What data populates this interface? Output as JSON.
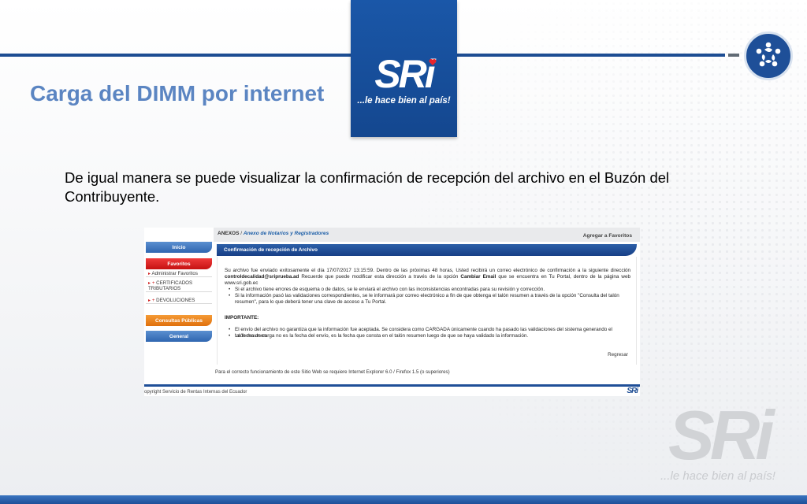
{
  "header": {
    "title": "Carga del DIMM por internet",
    "logo_text": "SRi",
    "logo_slogan": "...le hace bien al país!"
  },
  "body_text": "De igual manera se puede visualizar la confirmación de recepción del archivo en el Buzón del Contribuyente.",
  "screenshot": {
    "breadcrumb_section": "ANEXOS",
    "breadcrumb_page": "Anexo de Notarios y Registradores",
    "add_favorites": "Agregar a Favoritos",
    "menu": {
      "inicio": "Inicio",
      "favoritos": "Favoritos",
      "administrar": "Administrar Favoritos",
      "certificados": "CERTIFICADOS TRIBUTARIOS",
      "devoluciones": "DEVOLUCIONES",
      "consultas": "Consultas Públicas",
      "general": "General"
    },
    "panel_title": "Confirmación de recepción de Archivo",
    "message_intro": "Su archivo fue enviado exitosamente el día 17/07/2017 13:15:59. Dentro de las próximas 48 horas, Usted recibirá un correo electrónico de confirmación a la siguiente dirección ",
    "email": "controldecalidad@sriprueba.ad",
    "message_mid": " Recuerde que puede modificar esta dirección a través de la opción ",
    "option_name": "Cambiar Email",
    "message_end": " que se encuentra en Tu Portal, dentro de la página web www.sri.gob.ec",
    "bullets": [
      "Si el archivo tiene errores de esquema o de datos, se le enviará el archivo con las inconsistencias encontradas para su revisión y corrección.",
      "Si la información pasó las validaciones correspondientes, se le informará por correo electrónico a fin de que obtenga el talón resumen a través de la opción \"Consulta del talón resumen\", para lo que deberá tener una clave de acceso a Tu Portal."
    ],
    "important_label": "IMPORTANTE:",
    "important_bullets": [
      "El envío del archivo no garantiza que la información fue aceptada. Se considera como CARGADA únicamente cuando ha pasado las validaciones del sistema generando el talón resumen.",
      "La fecha de carga no es la fecha del envío, es la fecha que consta en el talón resumen luego de que se haya validado la información."
    ],
    "back_link": "Regresar",
    "footer_note": "Para el correcto funcionamiento de este Sitio Web se requiere Internet Explorer 6.0 / Firefox 1.5 (o superiores)",
    "copyright": "opyright Servicio de Rentas Internas del Ecuador",
    "mini_logo": "SRi"
  },
  "watermark": {
    "text": "SRi",
    "slogan": "...le hace bien al país!"
  },
  "colors": {
    "brand_blue": "#1d4d93",
    "title_blue": "#5b85c2",
    "menu_red": "#d01d1d",
    "menu_orange": "#e98420"
  }
}
